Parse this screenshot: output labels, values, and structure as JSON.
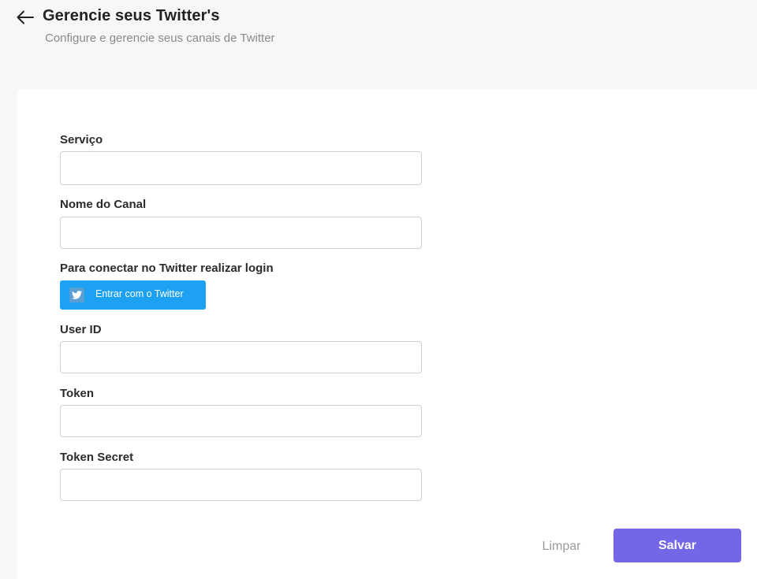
{
  "header": {
    "title": "Gerencie seus Twitter's",
    "subtitle": "Configure e gerencie seus canais de Twitter",
    "back_icon": "arrow-left-icon"
  },
  "form": {
    "service": {
      "label": "Serviço",
      "value": "",
      "placeholder": ""
    },
    "channel_name": {
      "label": "Nome do Canal",
      "value": "",
      "placeholder": ""
    },
    "twitter_login": {
      "label": "Para conectar no Twitter realizar login",
      "button_label": "Entrar com o Twitter",
      "icon": "twitter-bird-icon"
    },
    "user_id": {
      "label": "User ID",
      "value": "",
      "placeholder": ""
    },
    "token": {
      "label": "Token",
      "value": "",
      "placeholder": ""
    },
    "token_secret": {
      "label": "Token Secret",
      "value": "",
      "placeholder": ""
    }
  },
  "actions": {
    "clear_label": "Limpar",
    "save_label": "Salvar"
  },
  "colors": {
    "background": "#f7f7f8",
    "card": "#ffffff",
    "twitter_blue": "#1da1f2",
    "primary": "#7367e8",
    "muted_text": "#9a9aa0"
  }
}
